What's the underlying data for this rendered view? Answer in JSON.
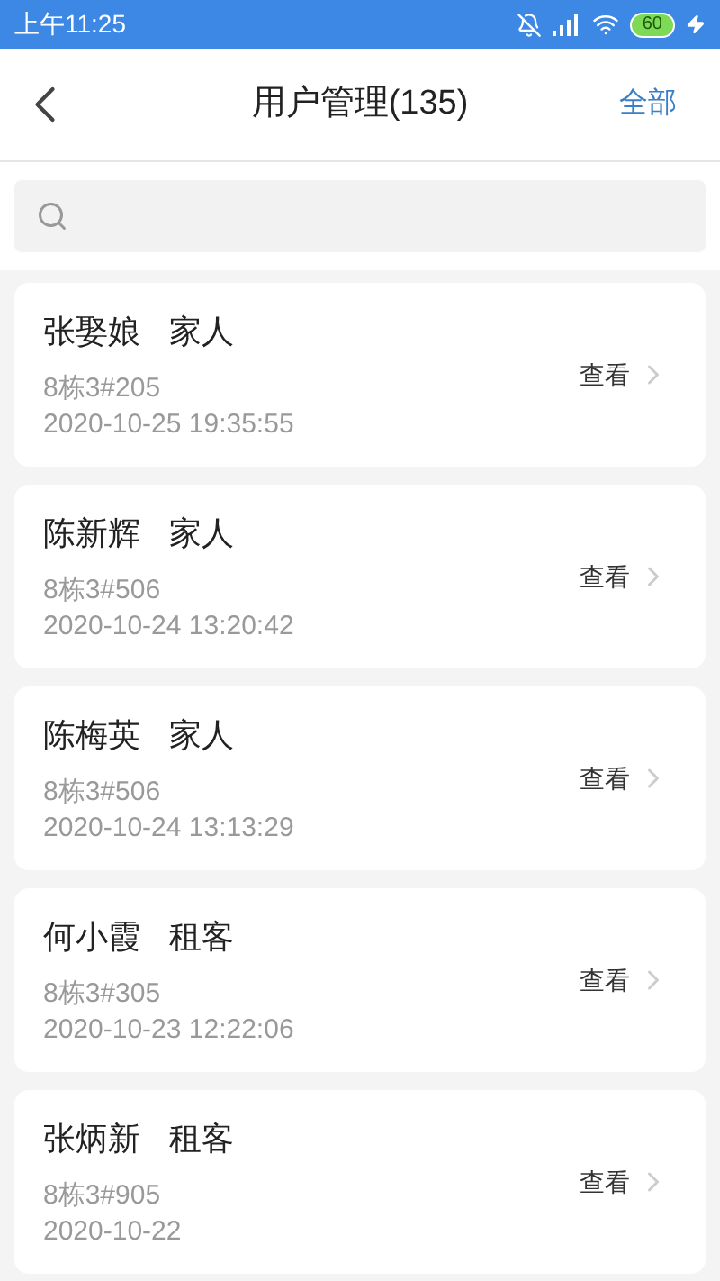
{
  "status_bar": {
    "time": "上午11:25",
    "battery": "60"
  },
  "header": {
    "title": "用户管理(135)",
    "action": "全部"
  },
  "users": [
    {
      "name": "张娶娘",
      "role": "家人",
      "unit": "8栋3#205",
      "time": "2020-10-25 19:35:55",
      "action": "查看"
    },
    {
      "name": "陈新辉",
      "role": "家人",
      "unit": "8栋3#506",
      "time": "2020-10-24 13:20:42",
      "action": "查看"
    },
    {
      "name": "陈梅英",
      "role": "家人",
      "unit": "8栋3#506",
      "time": "2020-10-24 13:13:29",
      "action": "查看"
    },
    {
      "name": "何小霞",
      "role": "租客",
      "unit": "8栋3#305",
      "time": "2020-10-23 12:22:06",
      "action": "查看"
    },
    {
      "name": "张炳新",
      "role": "租客",
      "unit": "8栋3#905",
      "time": "2020-10-22",
      "action": "查看"
    }
  ]
}
